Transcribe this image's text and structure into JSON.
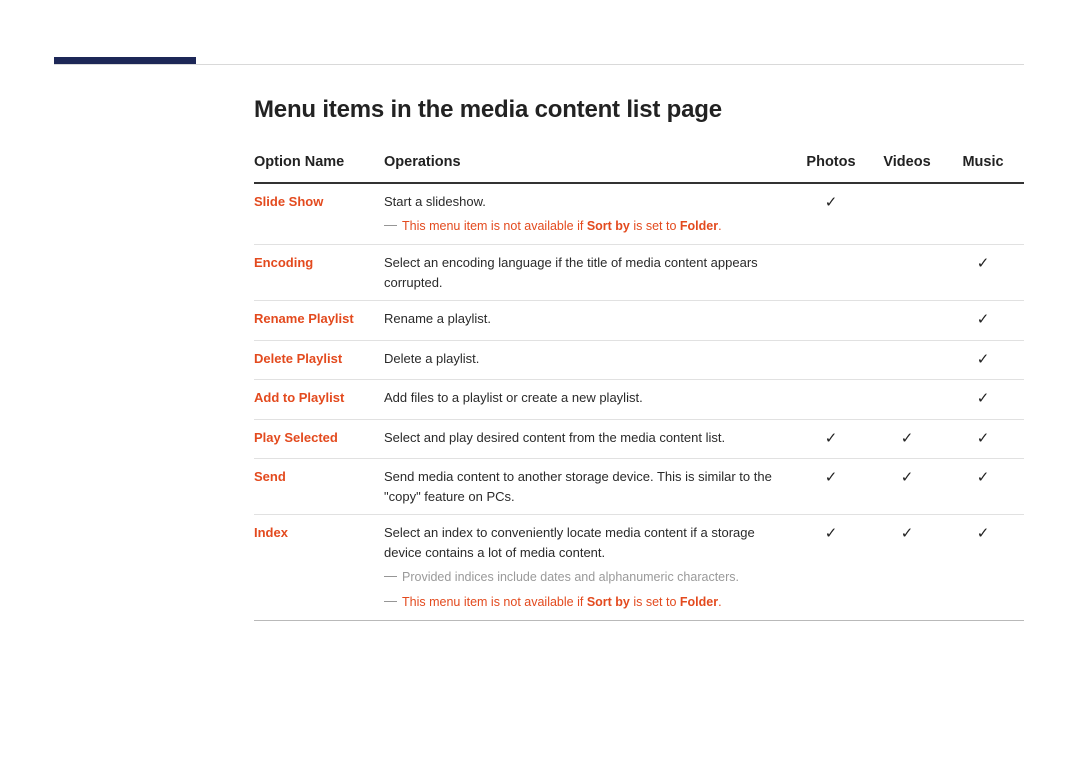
{
  "title": "Menu items in the media content list page",
  "columns": {
    "name": "Option Name",
    "ops": "Operations",
    "photos": "Photos",
    "videos": "Videos",
    "music": "Music"
  },
  "rows": [
    {
      "name": "Slide Show",
      "desc": "Start a slideshow.",
      "photos": true,
      "videos": false,
      "music": false,
      "notes": [
        {
          "type": "red",
          "pre": "This menu item is not available if ",
          "b1": "Sort by",
          "mid": " is set to ",
          "b2": "Folder",
          "post": "."
        }
      ]
    },
    {
      "name": "Encoding",
      "desc": "Select an encoding language if the title of media content appears corrupted.",
      "photos": false,
      "videos": false,
      "music": true,
      "notes": []
    },
    {
      "name": "Rename Playlist",
      "desc": "Rename a playlist.",
      "photos": false,
      "videos": false,
      "music": true,
      "notes": []
    },
    {
      "name": "Delete Playlist",
      "desc": "Delete a playlist.",
      "photos": false,
      "videos": false,
      "music": true,
      "notes": []
    },
    {
      "name": "Add to Playlist",
      "desc": "Add files to a playlist or create a new playlist.",
      "photos": false,
      "videos": false,
      "music": true,
      "notes": []
    },
    {
      "name": "Play Selected",
      "desc": "Select and play desired content from the media content list.",
      "photos": true,
      "videos": true,
      "music": true,
      "notes": []
    },
    {
      "name": "Send",
      "desc": "Send media content to another storage device. This is similar to the \"copy\" feature on PCs.",
      "photos": true,
      "videos": true,
      "music": true,
      "notes": []
    },
    {
      "name": "Index",
      "desc": "Select an index to conveniently locate media content if a storage device contains a lot of media content.",
      "photos": true,
      "videos": true,
      "music": true,
      "notes": [
        {
          "type": "gray",
          "pre": "Provided indices include dates and alphanumeric characters."
        },
        {
          "type": "red",
          "pre": "This menu item is not available if ",
          "b1": "Sort by",
          "mid": " is set to ",
          "b2": "Folder",
          "post": "."
        }
      ]
    }
  ],
  "check": "✓"
}
